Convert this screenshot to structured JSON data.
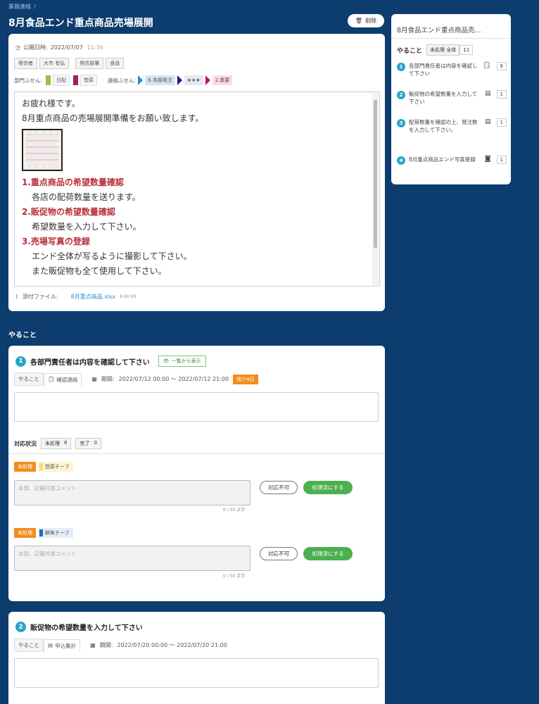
{
  "breadcrumb": {
    "items": [
      "業務連絡",
      "/"
    ]
  },
  "page_title": "8月食品エンド重点商品売場展開",
  "delete_label": "削除",
  "meta": {
    "label": "公開日時:",
    "date": "2022/07/07",
    "time": "11:36"
  },
  "tags": [
    "発信者",
    "大市 有弘",
    "発信部署",
    "食品"
  ],
  "fusen": {
    "dept_label": "部門ふせん:",
    "dept": [
      {
        "label": "日配",
        "color": "#8cc63f"
      },
      {
        "label": "惣菜",
        "color": "#9e1f63"
      }
    ],
    "contact_label": "連絡ふせん:",
    "contact": [
      {
        "label": "6.本部発注",
        "bg": "#d4e6f5",
        "arrow": "#1e90d8"
      },
      {
        "label": "★★★",
        "bg": "#e8e8f4",
        "arrow": "#1a237e"
      },
      {
        "label": "2.重要",
        "bg": "#f9dce4",
        "arrow": "#c2185b"
      }
    ]
  },
  "body": {
    "greeting": "お疲れ様です。",
    "intro": "8月重点商品の売場展開準備をお願い致します。",
    "s1_title": "1.重点商品の希望数量確認",
    "s1_text": "各店の配荷数量を送ります。",
    "s2_title": "2.販促物の希望数量確認",
    "s2_text": "希望数量を入力して下さい。",
    "s3_title": "3.売場写真の登録",
    "s3_text1": "エンド全体が写るように撮影して下さい。",
    "s3_text2": "また販促物も全て使用して下さい。"
  },
  "attachment": {
    "label": "添付ファイル:",
    "file": "8月重点商品.xlsx",
    "size": "8.68 KB"
  },
  "section_title": "やること",
  "task1": {
    "num": "1",
    "title": "各部門責任者は内容を確認して下さい",
    "show_btn": "一覧から表示",
    "tab1": "やること",
    "tab2": "確認連絡",
    "period_label": "期間:",
    "period": "2022/07/12  00:00  〜  2022/07/12  21:00",
    "remaining": "残り4日",
    "status_label": "対応状況",
    "s_unproc": "未処理",
    "s_unproc_n": "8",
    "s_done": "完了",
    "s_done_n": "0",
    "rows": [
      {
        "status": "未処理",
        "team": "惣菜チーフ",
        "color": "#f9dc7b",
        "placeholder": "本部、店舗共通コメント",
        "counter": "0 / 50 文字",
        "ng": "対応不可",
        "ok": "処理済にする"
      },
      {
        "status": "未処理",
        "team": "鮮魚チーフ",
        "color": "#1e6fb8",
        "placeholder": "本部、店舗共通コメント",
        "counter": "0 / 50 文字",
        "ng": "対応不可",
        "ok": "処理済にする"
      }
    ]
  },
  "task2": {
    "num": "2",
    "title": "販促物の希望数量を入力して下さい",
    "tab1": "やること",
    "tab2": "申込集計",
    "period_label": "期間:",
    "period": "2022/07/20  00:00  〜  2022/07/20  21:00"
  },
  "sidebar": {
    "title": "8月食品エンド重点商品売...",
    "todo_label": "やること",
    "status": "未処理 全体",
    "count": "11",
    "items": [
      {
        "num": "1",
        "text": "各部門責任者は内容を確認して下さい",
        "icon": "clipboard-icon",
        "count": "8"
      },
      {
        "num": "2",
        "text": "販促物の希望数量を入力して下さい",
        "icon": "calculator-icon",
        "count": "1"
      },
      {
        "num": "3",
        "text": "配荷数量を確認の上、発注数を入力して下さい。",
        "icon": "calculator-icon",
        "count": "1"
      },
      {
        "num": "4",
        "text": "8月重点商品エンド写真登録",
        "icon": "camera-icon",
        "count": "1"
      }
    ]
  },
  "colors": {
    "background": "#0d3c6e",
    "accent": "#28a5c8",
    "warning": "#f28c1e",
    "success": "#4caf50",
    "heading_red": "#b5303a"
  }
}
